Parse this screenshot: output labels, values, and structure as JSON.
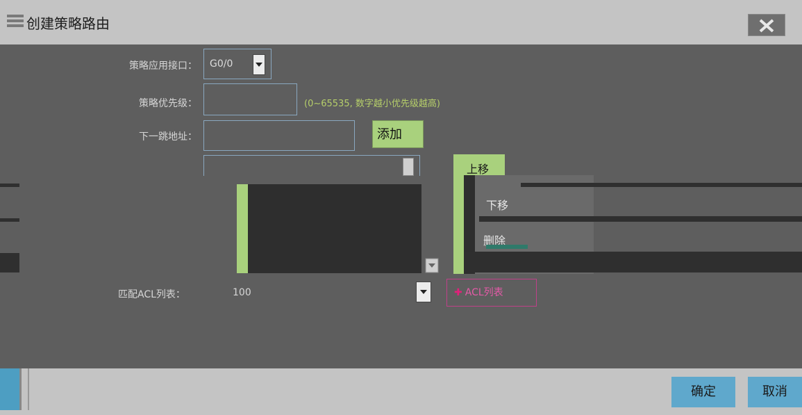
{
  "window": {
    "title": "创建策略路由",
    "close_icon": "close-icon"
  },
  "form": {
    "interface_label": "策略应用接口：",
    "interface_value": "G0/0",
    "priority_label": "策略优先级：",
    "priority_hint": "(0~65535, 数字越小优先级越高)",
    "nexthop_label": "下一跳地址：",
    "add_button": "添加",
    "move_up_button": "上移",
    "move_down_button": "下移",
    "delete_button": "删除",
    "acl_label": "匹配ACL列表：",
    "acl_value": "100",
    "acl_button": "ACL列表"
  },
  "footer": {
    "ok_button": "确定",
    "cancel_button": "取消"
  },
  "colors": {
    "accent_green": "#a9d17d",
    "accent_blue": "#5fa8cc",
    "acl_pink": "#e0207a"
  }
}
